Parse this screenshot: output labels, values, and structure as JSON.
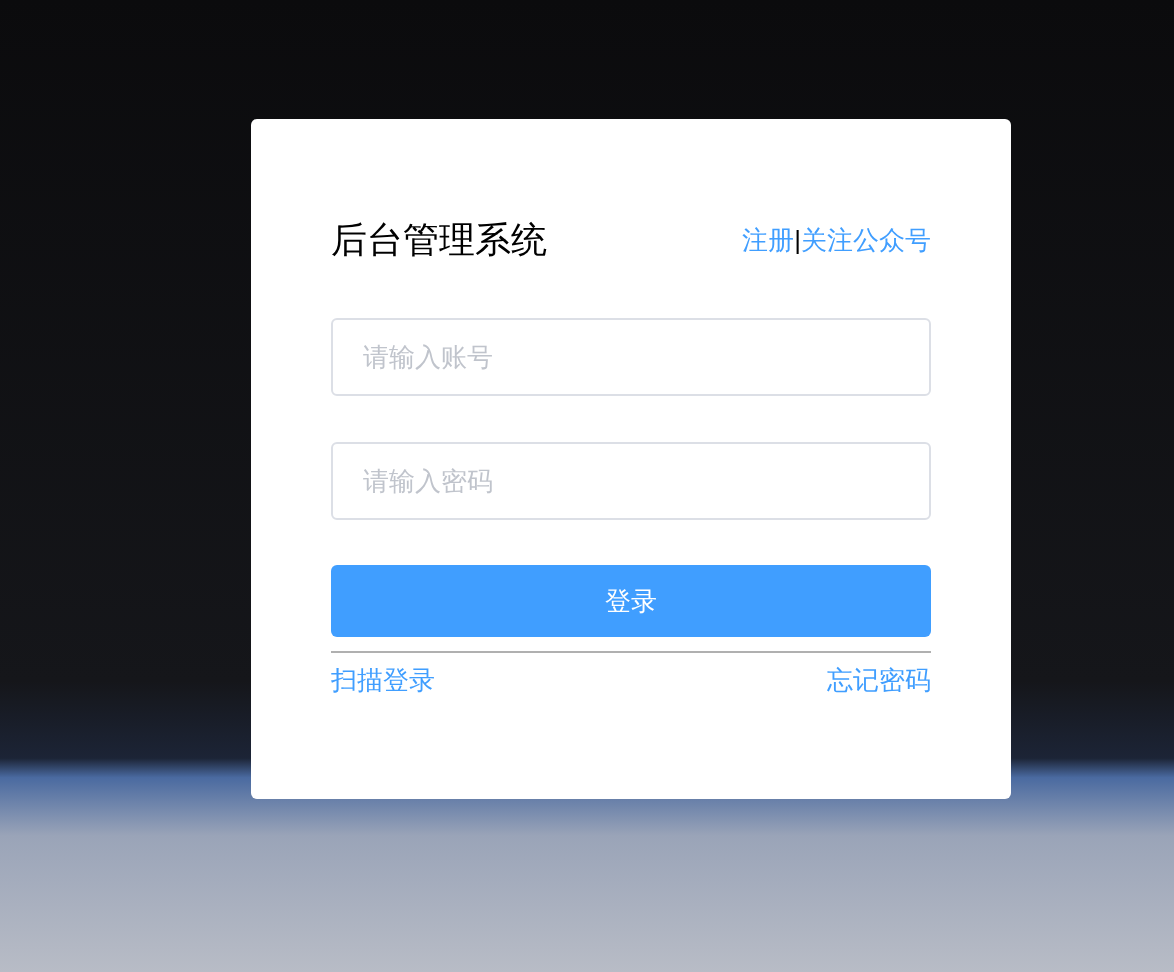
{
  "title": "后台管理系统",
  "header_links": [
    {
      "label": "注册"
    },
    {
      "label": "关注公众号"
    }
  ],
  "header_separator": "|",
  "fields": [
    {
      "placeholder": "请输入账号"
    },
    {
      "placeholder": "请输入密码"
    }
  ],
  "login_button": "登录",
  "footer_links": [
    {
      "label": "扫描登录"
    },
    {
      "label": "忘记密码"
    }
  ]
}
